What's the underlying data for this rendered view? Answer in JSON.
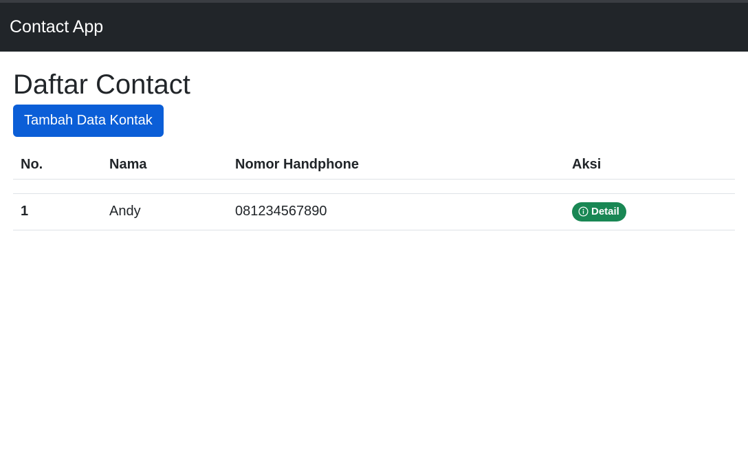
{
  "navbar": {
    "brand": "Contact App"
  },
  "main": {
    "title": "Daftar Contact",
    "add_button_label": "Tambah Data Kontak"
  },
  "table": {
    "headers": {
      "no": "No.",
      "nama": "Nama",
      "nomor": "Nomor Handphone",
      "aksi": "Aksi"
    },
    "rows": [
      {
        "no": "1",
        "nama": "Andy",
        "nomor": "081234567890",
        "action_label": "Detail",
        "action_icon": "info-circle-icon"
      }
    ]
  },
  "colors": {
    "navbar_bg": "#212529",
    "primary": "#0b5ed7",
    "success": "#198754"
  }
}
